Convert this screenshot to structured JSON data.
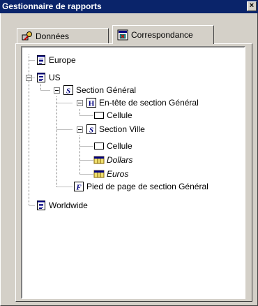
{
  "window": {
    "title": "Gestionnaire de rapports",
    "close_label": "×"
  },
  "tabs": [
    {
      "label": "Données"
    },
    {
      "label": "Correspondance"
    }
  ],
  "tree": {
    "europe": "Europe",
    "us": "US",
    "section_general": "Section Général",
    "entete_section_general": "En-tête de section Général",
    "cellule_1": "Cellule",
    "section_ville": "Section Ville",
    "cellule_2": "Cellule",
    "dollars": "Dollars",
    "euros": "Euros",
    "pied_de_page": "Pied de page de section Général",
    "worldwide": "Worldwide"
  }
}
